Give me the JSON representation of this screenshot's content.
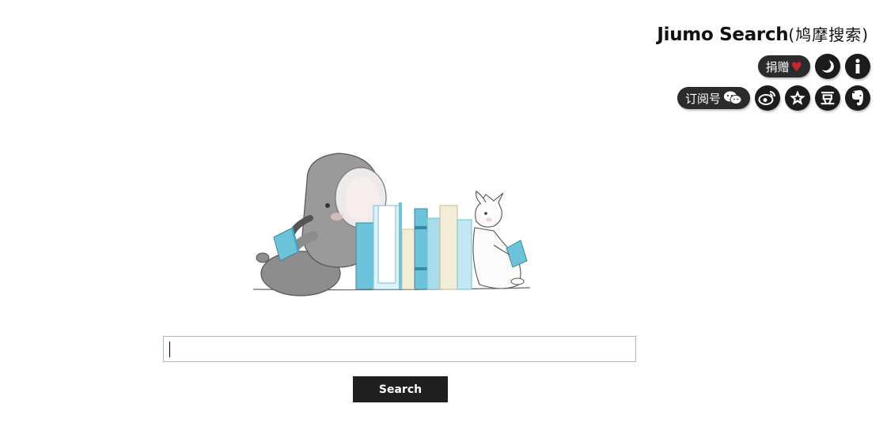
{
  "brand": {
    "name": "Jiumo Search",
    "cn": "(鸠摩搜索)"
  },
  "header": {
    "donate_label": "捐赠",
    "donate_heart": "♥",
    "subscribe_label": "订阅号"
  },
  "icons": {
    "heart": "heart-icon",
    "night_mode": "moon-icon",
    "info": "info-icon",
    "wechat": "wechat-icon",
    "weibo": "weibo-icon",
    "favorite": "star-icon",
    "douban": "douban-icon",
    "evernote": "evernote-icon"
  },
  "douban_glyph": "豆",
  "search": {
    "placeholder": "",
    "value": "",
    "button_label": "Search"
  },
  "colors": {
    "dark": "#1f1f1f",
    "heart": "#d0242b",
    "input_border": "#9fb8cf",
    "book_blue": "#6cc3da"
  }
}
